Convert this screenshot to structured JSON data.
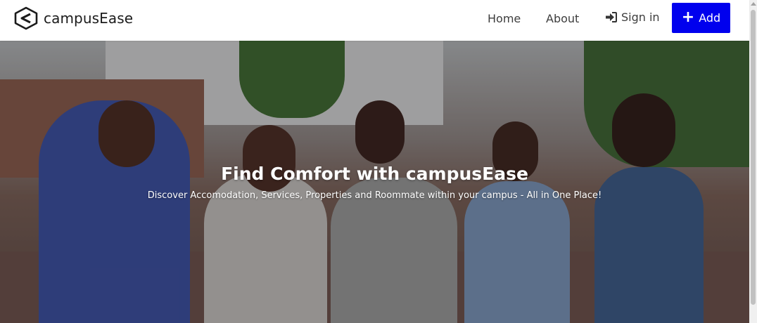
{
  "navbar": {
    "brand": "campusEase",
    "links": {
      "home": "Home",
      "about": "About",
      "sign_in": "Sign in"
    },
    "add_button": "Add"
  },
  "hero": {
    "title": "Find Comfort with campusEase",
    "subtitle": "Discover Accomodation, Services, Properties and Roommate within your campus - All in One Place!"
  },
  "colors": {
    "accent": "#0000ee",
    "nav_text": "#3d3d3d",
    "hero_text": "#ffffff"
  },
  "icons": [
    "logo-icon",
    "sign-in-icon",
    "plus-icon"
  ]
}
